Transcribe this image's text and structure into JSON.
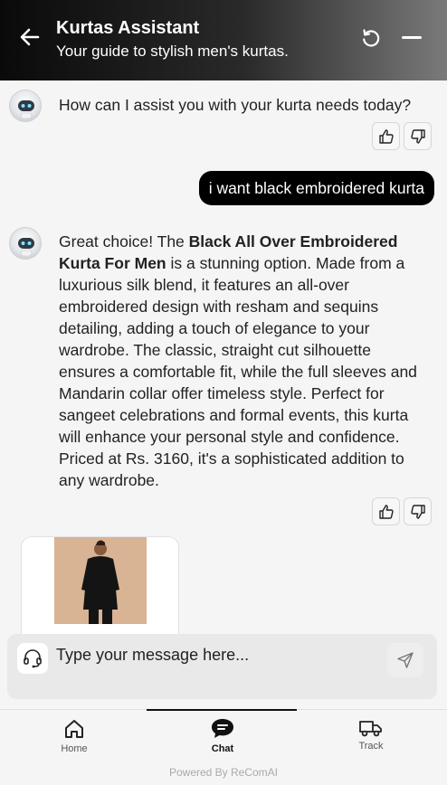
{
  "header": {
    "title": "Kurtas Assistant",
    "subtitle": "Your guide to stylish men's kurtas."
  },
  "chat": {
    "greeting": "How can I assist you with your kurta needs today?",
    "user_message": "i want black embroidered kurta",
    "reply": {
      "intro": "Great choice! The ",
      "product_name": "Black All Over Embroidered Kurta For Men",
      "body": " is a stunning option. Made from a luxurious silk blend, it features an all-over embroidered design with resham and sequins detailing, adding a touch of elegance to your wardrobe. The classic, straight cut silhouette ensures a comfortable fit, while the full sleeves and Mandarin collar offer timeless style. Perfect for sangeet celebrations and formal events, this kurta will enhance your personal style and confidence. Priced at Rs. 3160, it's a sophisticated addition to any wardrobe."
    }
  },
  "input": {
    "placeholder": "Type your message here..."
  },
  "nav": {
    "home": "Home",
    "chat": "Chat",
    "track": "Track",
    "active": "chat"
  },
  "footer": {
    "powered_by": "Powered By ReComAI"
  },
  "colors": {
    "header_start": "#0a0a0a",
    "header_end": "#7a7a7a",
    "user_bubble": "#000000",
    "background": "#f5f5f5"
  },
  "icons": [
    "back-arrow-icon",
    "refresh-icon",
    "minimize-icon",
    "bot-avatar",
    "thumbs-up-icon",
    "thumbs-down-icon",
    "headset-icon",
    "send-icon",
    "home-icon",
    "chat-icon",
    "truck-icon"
  ]
}
